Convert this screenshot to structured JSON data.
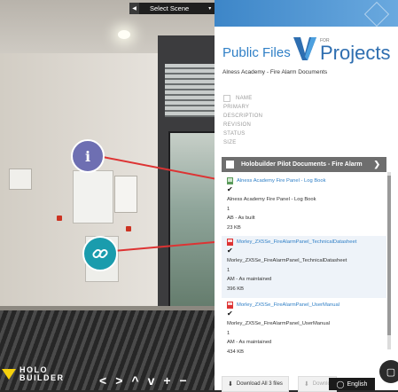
{
  "scene": {
    "select_label": "Select Scene",
    "prev_icon": "chevron-left-icon",
    "next_icon": "chevron-right-icon"
  },
  "hotspots": [
    {
      "type": "info",
      "glyph": "i",
      "icon": "info-icon",
      "color": "#6e6fb2"
    },
    {
      "type": "link",
      "icon": "link-icon",
      "color": "#1a9cad"
    }
  ],
  "logo": {
    "line1": "HOLO",
    "line2": "BUILDER"
  },
  "nav": {
    "left": "<",
    "right": ">",
    "up": "^",
    "down": "v",
    "zoom_in": "+",
    "zoom_out": "−",
    "fullscreen": "⛶"
  },
  "panel": {
    "title": "Public Files",
    "brand_for": "FOR",
    "brand_name": "Projects",
    "subtitle": "Alness Academy - Fire Alarm Documents",
    "filters": [
      "NAME",
      "PRIMARY",
      "DESCRIPTION",
      "REVISION",
      "STATUS",
      "SIZE"
    ],
    "group": {
      "title": "Holobuilder Pilot Documents - Fire Alarm"
    },
    "files": [
      {
        "link": "Alness Academy Fire Panel - Log Book",
        "icon": "image-file-icon",
        "check": "✔",
        "name": "Alness Academy Fire Panel - Log Book",
        "primary": "1",
        "status": "AB - As built",
        "size": "23 KB"
      },
      {
        "link": "Morley_ZX5Se_FireAlarmPanel_TechnicalDatasheet",
        "icon": "pdf-file-icon",
        "check": "✔",
        "name": "Morley_ZX5Se_FireAlarmPanel_TechnicalDatasheet",
        "primary": "1",
        "status": "AM - As maintained",
        "size": "396 KB"
      },
      {
        "link": "Morley_ZX5Se_FireAlarmPanel_UserManual",
        "icon": "pdf-file-icon",
        "check": "✔",
        "name": "Morley_ZX5Se_FireAlarmPanel_UserManual",
        "primary": "1",
        "status": "AM - As maintained",
        "size": "434 KB"
      }
    ],
    "download_all": "Download All 3 files",
    "download_other": "Downlo",
    "language": "English"
  },
  "colors": {
    "accent": "#2f7fc6",
    "group_header": "#6e6e6e",
    "link_hotspot": "#1a9cad",
    "info_hotspot": "#6e6fb2",
    "connector": "#dd3333"
  }
}
